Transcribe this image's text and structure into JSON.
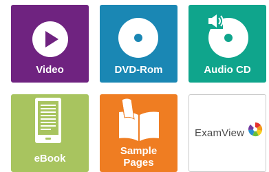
{
  "tiles": {
    "video": {
      "label": "Video",
      "color": "#6f2380",
      "icon": "play-icon"
    },
    "dvd": {
      "label": "DVD-Rom",
      "color": "#1a87b4",
      "icon": "disc-icon"
    },
    "audio": {
      "label": "Audio CD",
      "color": "#0fa58c",
      "icon": "audio-disc-icon"
    },
    "ebook": {
      "label": "eBook",
      "color": "#a8c45f",
      "icon": "ereader-icon"
    },
    "sample": {
      "label_line1": "Sample",
      "label_line2": "Pages",
      "color": "#ef7d22",
      "icon": "open-book-icon"
    },
    "examview": {
      "label": "ExamView",
      "icon": "examview-logo"
    }
  }
}
